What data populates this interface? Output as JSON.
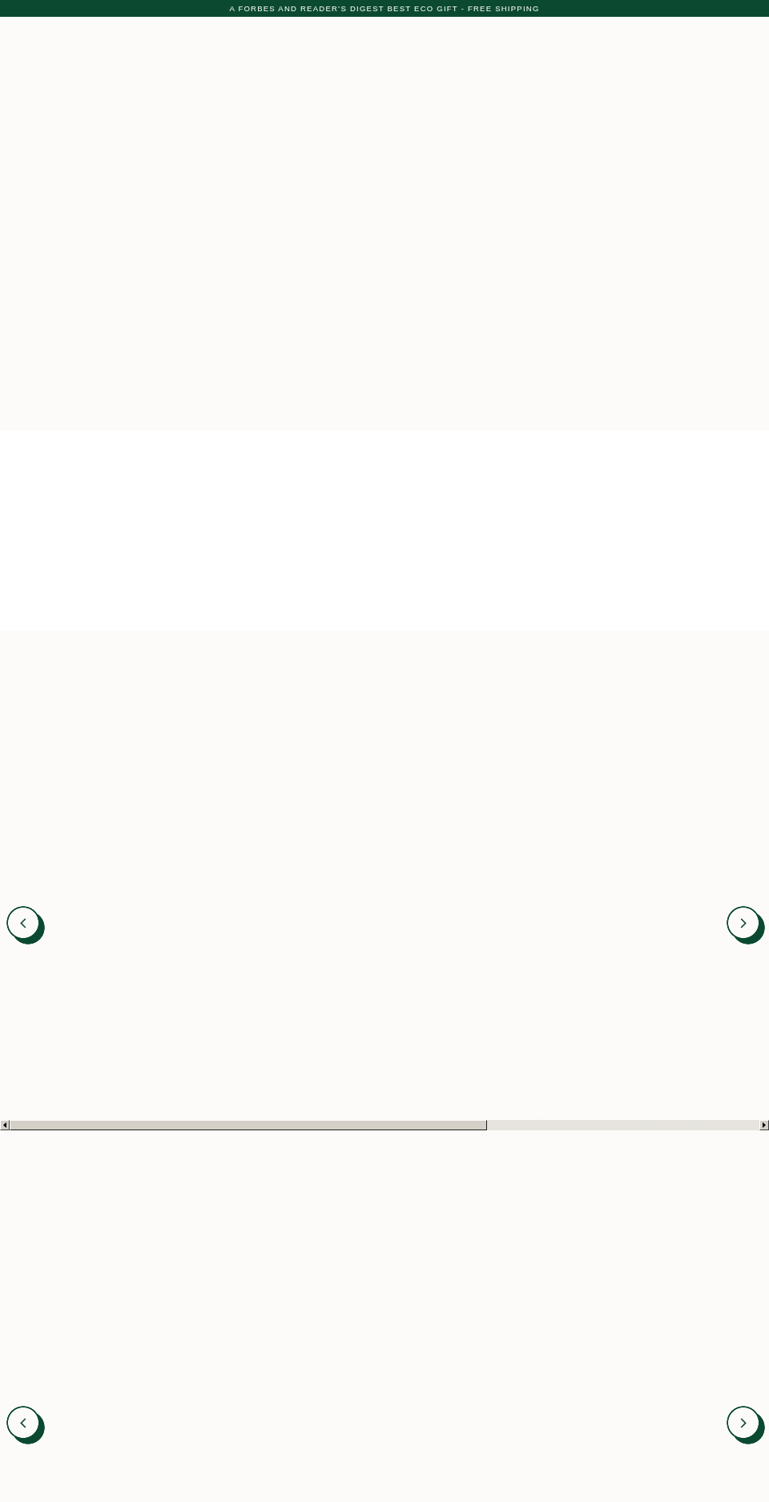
{
  "announcement": {
    "text": "A FORBES AND READER’S DIGEST BEST ECO GIFT - FREE SHIPPING"
  },
  "carousels": [
    {
      "scrollbar": true
    },
    {
      "scrollbar": false
    }
  ]
}
